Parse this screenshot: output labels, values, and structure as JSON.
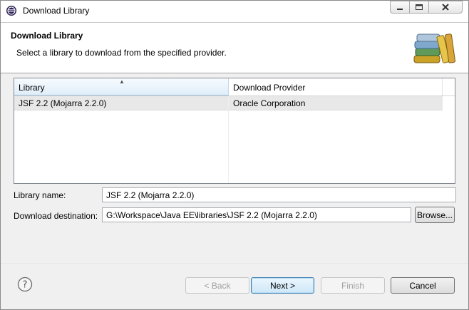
{
  "window": {
    "title": "Download Library"
  },
  "banner": {
    "title": "Download Library",
    "description": "Select a library to download from the specified provider."
  },
  "table": {
    "headers": [
      "Library",
      "Download Provider"
    ],
    "rows": [
      {
        "library": "JSF 2.2 (Mojarra 2.2.0)",
        "provider": "Oracle Corporation"
      }
    ]
  },
  "form": {
    "library_name_label": "Library name:",
    "library_name_value": "JSF 2.2 (Mojarra 2.2.0)",
    "destination_label": "Download destination:",
    "destination_value": "G:\\Workspace\\Java EE\\libraries\\JSF 2.2 (Mojarra 2.2.0)",
    "browse_label": "Browse..."
  },
  "buttons": {
    "back": "< Back",
    "next": "Next >",
    "finish": "Finish",
    "cancel": "Cancel"
  },
  "icons": {
    "app": "eclipse-icon",
    "banner": "books-icon",
    "help": "help-icon"
  }
}
